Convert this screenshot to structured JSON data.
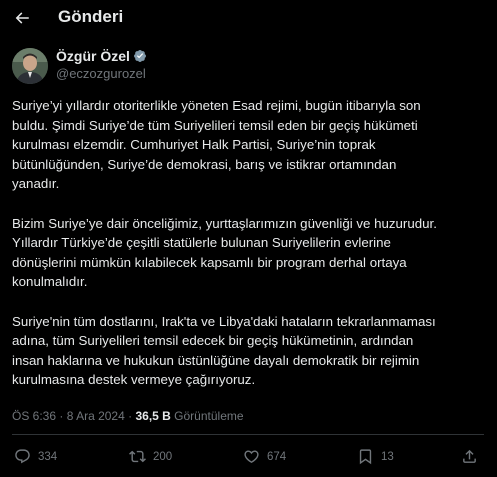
{
  "header": {
    "title": "Gönderi"
  },
  "author": {
    "display_name": "Özgür Özel",
    "handle": "@eczozgurozel"
  },
  "tweet": {
    "paragraphs": [
      [
        "Suriye’yi yıllardır otoriterlikle yöneten Esad rejimi, bugün itibarıyla son",
        "buldu. Şimdi Suriye’de tüm Suriyelileri temsil eden bir geçiş hükümeti",
        "kurulması elzemdir. Cumhuriyet Halk Partisi, Suriye’nin toprak",
        "bütünlüğünden, Suriye’de demokrasi, barış ve istikrar ortamından",
        "yanadır."
      ],
      [
        "Bizim Suriye’ye dair önceliğimiz, yurttaşlarımızın güvenliği ve huzurudur.",
        "Yıllardır Türkiye’de çeşitli statülerle bulunan Suriyelilerin evlerine",
        "dönüşlerini mümkün kılabilecek kapsamlı bir program derhal ortaya",
        "konulmalıdır."
      ],
      [
        "Suriye'nin tüm dostlarını, Irak'ta ve Libya'daki hataların tekrarlanmaması",
        "adına, tüm Suriyelileri temsil edecek bir geçiş hükümetinin, ardından",
        "insan haklarına ve hukukun üstünlüğüne dayalı demokratik bir rejimin",
        "kurulmasına destek vermeye çağırıyoruz."
      ]
    ]
  },
  "meta": {
    "time": "ÖS 6:36",
    "sep": "·",
    "date": "8 Ara 2024",
    "views": "36,5 B",
    "views_label": "Görüntüleme"
  },
  "actions": {
    "replies": "334",
    "reposts": "200",
    "likes": "674",
    "bookmarks": "13"
  },
  "colors": {
    "background": "#000000",
    "text": "#e7e9ea",
    "muted": "#71767b",
    "verified": "#829aab",
    "divider": "#2f3336"
  }
}
